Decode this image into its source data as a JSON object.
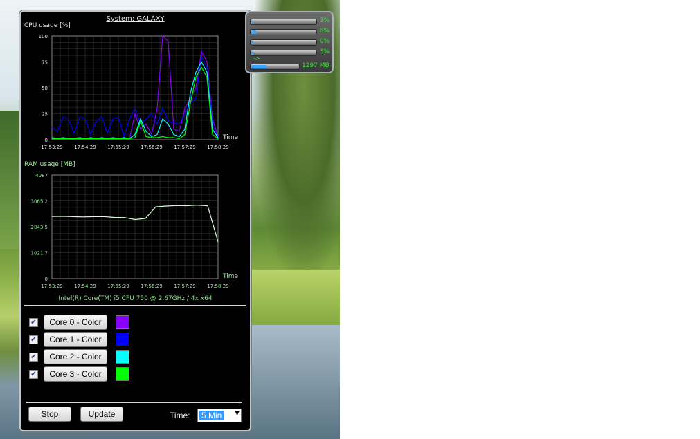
{
  "system_title": "System: GALAXY",
  "cpu_chart": {
    "label": "CPU usage [%]",
    "x_label": "Time",
    "y_ticks": [
      "100",
      "75",
      "50",
      "25",
      "0"
    ],
    "x_ticks": [
      "17:53:29",
      "17:54:29",
      "17:55:29",
      "17:56:29",
      "17:57:29",
      "17:58:29"
    ],
    "ylim": [
      0,
      100
    ]
  },
  "ram_chart": {
    "label": "RAM usage [MB]",
    "x_label": "Time",
    "y_ticks": [
      "4087",
      "3065.2",
      "2043.5",
      "1021.7",
      "0"
    ],
    "x_ticks": [
      "17:53:29",
      "17:54:29",
      "17:55:29",
      "17:56:29",
      "17:57:29",
      "17:58:29"
    ],
    "ylim": [
      0,
      4087
    ]
  },
  "cpu_name": "Intel(R) Core(TM) i5 CPU 750 @ 2.67GHz / 4x x64",
  "cores": [
    {
      "label": "Core 0 - Color",
      "checked": "✔",
      "color": "#8a00ff"
    },
    {
      "label": "Core 1 - Color",
      "checked": "✔",
      "color": "#0000ff"
    },
    {
      "label": "Core 2 - Color",
      "checked": "✔",
      "color": "#00ffff"
    },
    {
      "label": "Core 3 - Color",
      "checked": "✔",
      "color": "#00ff00"
    }
  ],
  "buttons": {
    "stop": "Stop",
    "update": "Update"
  },
  "time": {
    "label": "Time:",
    "value": "5 Min"
  },
  "meter": {
    "cores": [
      {
        "value": "2%",
        "fraction": 0.02
      },
      {
        "value": "8%",
        "fraction": 0.08
      },
      {
        "value": "0%",
        "fraction": 0.0
      },
      {
        "value": "3%",
        "fraction": 0.03
      }
    ],
    "arrow": "->",
    "ram_value": "1297 MB",
    "ram_fraction": 0.32
  },
  "chart_data": [
    {
      "type": "line",
      "title": "CPU usage [%]",
      "xlabel": "Time",
      "x": [
        "17:53:29",
        "17:53:39",
        "17:53:49",
        "17:53:59",
        "17:54:09",
        "17:54:19",
        "17:54:29",
        "17:54:39",
        "17:54:49",
        "17:54:59",
        "17:55:09",
        "17:55:19",
        "17:55:29",
        "17:55:39",
        "17:55:49",
        "17:55:59",
        "17:56:09",
        "17:56:19",
        "17:56:29",
        "17:56:39",
        "17:56:49",
        "17:56:59",
        "17:57:09",
        "17:57:19",
        "17:57:29",
        "17:57:39",
        "17:57:49",
        "17:57:59",
        "17:58:09",
        "17:58:19",
        "17:58:29"
      ],
      "ylim": [
        0,
        100
      ],
      "series": [
        {
          "color": "#8a00ff",
          "values": [
            2,
            1,
            2,
            1,
            1,
            2,
            1,
            2,
            1,
            2,
            1,
            2,
            1,
            2,
            1,
            25,
            10,
            15,
            5,
            30,
            100,
            95,
            10,
            8,
            30,
            40,
            50,
            85,
            75,
            20,
            3
          ]
        },
        {
          "color": "#0000ff",
          "values": [
            12,
            8,
            22,
            20,
            6,
            22,
            20,
            5,
            18,
            22,
            6,
            20,
            22,
            3,
            20,
            30,
            15,
            20,
            25,
            15,
            30,
            18,
            16,
            15,
            25,
            35,
            40,
            80,
            70,
            15,
            2
          ]
        },
        {
          "color": "#00ffff",
          "values": [
            2,
            1,
            2,
            1,
            1,
            2,
            1,
            2,
            1,
            2,
            1,
            2,
            1,
            2,
            1,
            5,
            20,
            8,
            3,
            5,
            20,
            15,
            5,
            3,
            10,
            45,
            65,
            75,
            65,
            10,
            2
          ]
        },
        {
          "color": "#00ff00",
          "values": [
            1,
            1,
            1,
            1,
            1,
            1,
            1,
            1,
            1,
            1,
            1,
            1,
            1,
            1,
            1,
            2,
            18,
            3,
            2,
            2,
            3,
            2,
            2,
            1,
            5,
            35,
            60,
            70,
            60,
            5,
            1
          ]
        }
      ]
    },
    {
      "type": "line",
      "title": "RAM usage [MB]",
      "xlabel": "Time",
      "x": [
        "17:53:29",
        "17:54:29",
        "17:55:29",
        "17:56:29",
        "17:57:29",
        "17:58:29"
      ],
      "ylim": [
        0,
        4087
      ],
      "series": [
        {
          "color": "#d6ffd6",
          "values": [
            2450,
            2455,
            2440,
            2430,
            2440,
            2445,
            2410,
            2405,
            2330,
            2370,
            2830,
            2860,
            2880,
            2875,
            2900,
            2870,
            1450
          ]
        }
      ]
    }
  ]
}
